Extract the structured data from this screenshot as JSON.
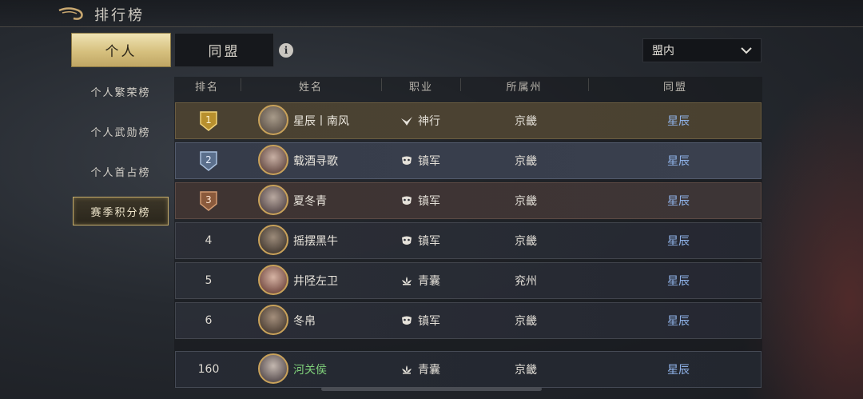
{
  "header": {
    "title": "排行榜"
  },
  "tabs": [
    {
      "label": "个人",
      "active": true
    },
    {
      "label": "同盟",
      "active": false
    }
  ],
  "filter": {
    "selected": "盟内"
  },
  "sidebar": {
    "items": [
      {
        "label": "个人繁荣榜",
        "active": false
      },
      {
        "label": "个人武勋榜",
        "active": false
      },
      {
        "label": "个人首占榜",
        "active": false
      },
      {
        "label": "赛季积分榜",
        "active": true
      }
    ]
  },
  "table": {
    "columns": [
      "排名",
      "姓名",
      "职业",
      "所属州",
      "同盟"
    ],
    "rows": [
      {
        "rank": "1",
        "name": "星辰丨南风",
        "job": "神行",
        "region": "京畿",
        "alliance": "星辰"
      },
      {
        "rank": "2",
        "name": "载酒寻歌",
        "job": "镇军",
        "region": "京畿",
        "alliance": "星辰"
      },
      {
        "rank": "3",
        "name": "夏冬青",
        "job": "镇军",
        "region": "京畿",
        "alliance": "星辰"
      },
      {
        "rank": "4",
        "name": "摇摆黑牛",
        "job": "镇军",
        "region": "京畿",
        "alliance": "星辰"
      },
      {
        "rank": "5",
        "name": "井陉左卫",
        "job": "青囊",
        "region": "兖州",
        "alliance": "星辰"
      },
      {
        "rank": "6",
        "name": "冬帛",
        "job": "镇军",
        "region": "京畿",
        "alliance": "星辰"
      }
    ],
    "self_row": {
      "rank": "160",
      "name": "河关侯",
      "job": "青囊",
      "region": "京畿",
      "alliance": "星辰"
    }
  },
  "colors": {
    "accent_gold": "#d6c07e",
    "alliance_blue": "#8fb2e8",
    "self_name_green": "#7fd07a"
  },
  "icons": {
    "job_shenxing": "eagle-icon",
    "job_zhenjun": "demon-mask-icon",
    "job_qingnang": "lotus-icon"
  }
}
